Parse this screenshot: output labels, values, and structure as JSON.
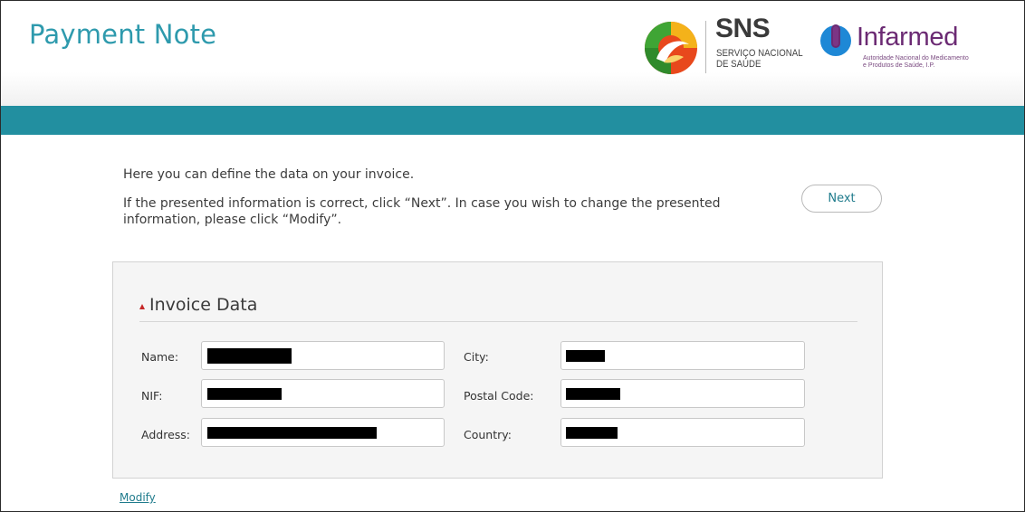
{
  "header": {
    "title": "Payment Note",
    "sns_logo": {
      "title": "SNS",
      "subtitle_line1": "SERVIÇO NACIONAL",
      "subtitle_line2": "DE SAÚDE"
    },
    "infarmed_logo": {
      "title": "Infarmed",
      "subtitle_line1": "Autoridade Nacional do Medicamento",
      "subtitle_line2": "e Produtos de Saúde, I.P."
    }
  },
  "intro": {
    "line1": "Here you can define the data on your invoice.",
    "line2": "If the presented information is correct, click “Next”. In case you wish to change the presented information, please click “Modify”."
  },
  "actions": {
    "next_label": "Next",
    "modify_label": "Modify"
  },
  "invoice": {
    "section_title": "Invoice Data",
    "fields": {
      "name": {
        "label": "Name:"
      },
      "nif": {
        "label": "NIF:"
      },
      "address": {
        "label": "Address:"
      },
      "city": {
        "label": "City:"
      },
      "postal_code": {
        "label": "Postal Code:"
      },
      "country": {
        "label": "Country:"
      }
    }
  },
  "colors": {
    "accent": "#2e9aad",
    "bar": "#228fa0",
    "link": "#1f7b8c",
    "infarmed": "#6b2a73",
    "triangle": "#c62828"
  },
  "icons": {
    "sns": "sns-logo-icon",
    "infarmed": "infarmed-icon",
    "section": "triangle-up-icon"
  }
}
